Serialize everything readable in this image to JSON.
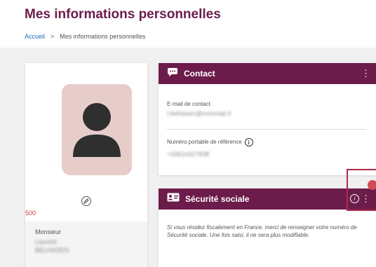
{
  "header": {
    "title": "Mes informations personnelles",
    "breadcrumb": [
      {
        "label": "Accueil"
      },
      {
        "label": "Mes informations personnelles"
      }
    ],
    "separator": ">"
  },
  "profile": {
    "code": "500",
    "civility": "Monsieur",
    "first_name": "Laurent",
    "last_name": "BELHASEN"
  },
  "contact_card": {
    "title": "Contact",
    "email_label": "E-mail de contact",
    "email_value": "l.belhasen@monmail.fr",
    "phone_label": "Numéro portable de référence",
    "phone_value": "+33614327838"
  },
  "secu_card": {
    "title": "Sécurité sociale",
    "text": "Si vous résidez fiscalement en France, merci de renseigner votre numéro de Sécurité sociale. Une fois saisi, il ne sera plus modifiable."
  },
  "colors": {
    "brand": "#6c1c4a",
    "title": "#6b1c4b",
    "link": "#1e6bb8",
    "accent_red": "#d6333f",
    "highlight": "#b02a4c"
  },
  "icons": {
    "contact": "chat-bubble-icon",
    "secu": "id-card-icon",
    "info": "info-icon",
    "menu": "kebab-menu-icon",
    "edit": "edit-pencil-icon"
  }
}
